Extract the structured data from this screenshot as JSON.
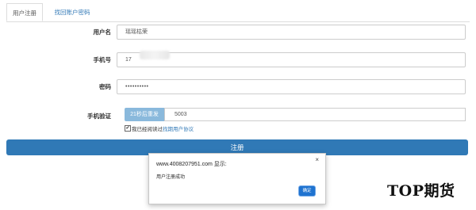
{
  "tabs": {
    "register": "用户注册",
    "recover": "找回账户密码"
  },
  "form": {
    "username_label": "用户名",
    "username_value": "瑶瑶枯荣",
    "phone_label": "手机号",
    "phone_value": "17",
    "password_label": "密码",
    "password_value": "••••••••••",
    "sms_label": "手机验证",
    "sms_button": "21秒后重发",
    "sms_value": "5003",
    "agree_text": "我已经阅读过",
    "agree_link": "找期用户协议",
    "agree_checkmark": "✔",
    "agree_checked": true,
    "submit": "注册"
  },
  "dialog": {
    "title": "www.4008207951.com 显示:",
    "close": "×",
    "message": "用户注册成功",
    "ok": "确定"
  },
  "watermark": "TOP期货",
  "colors": {
    "primary": "#3079b6",
    "sms_button": "#8ab9dc",
    "link": "#337ab7",
    "dialog_ok": "#1f73d0"
  }
}
